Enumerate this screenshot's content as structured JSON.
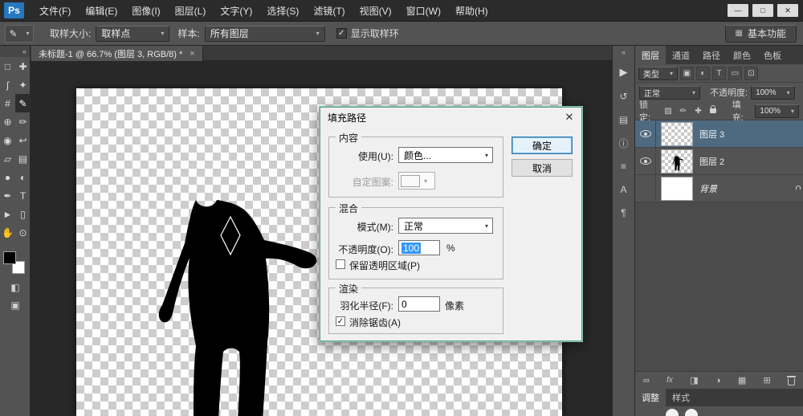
{
  "icons": {
    "check": "✓",
    "arrow": "▾",
    "collapse_left": "«",
    "play": "▶"
  },
  "menubar": {
    "logo": "Ps",
    "items": [
      "文件(F)",
      "编辑(E)",
      "图像(I)",
      "图层(L)",
      "文字(Y)",
      "选择(S)",
      "滤镜(T)",
      "视图(V)",
      "窗口(W)",
      "帮助(H)"
    ],
    "minimize": "—",
    "maximize": "□",
    "close": "✕"
  },
  "options_bar": {
    "tool_glyph": "✎",
    "sample_size_label": "取样大小:",
    "sample_size_value": "取样点",
    "sample_label": "样本:",
    "sample_value": "所有图层",
    "show_ring_label": "显示取样环",
    "workspace_glyph": "▦",
    "workspace_label": "基本功能"
  },
  "toolbar": {
    "tools": [
      {
        "name": "rectangular-marquee",
        "glyph": "□"
      },
      {
        "name": "move",
        "glyph": "✚"
      },
      {
        "name": "lasso",
        "glyph": "ʃ"
      },
      {
        "name": "quick-selection",
        "glyph": "✦"
      },
      {
        "name": "crop",
        "glyph": "#"
      },
      {
        "name": "eyedropper",
        "glyph": "✎"
      },
      {
        "name": "spot-healing",
        "glyph": "⊕"
      },
      {
        "name": "brush",
        "glyph": "✏"
      },
      {
        "name": "clone-stamp",
        "glyph": "◉"
      },
      {
        "name": "history-brush",
        "glyph": "↩"
      },
      {
        "name": "eraser",
        "glyph": "▱"
      },
      {
        "name": "gradient",
        "glyph": "▤"
      },
      {
        "name": "blur",
        "glyph": "●"
      },
      {
        "name": "dodge",
        "glyph": "◐"
      },
      {
        "name": "pen",
        "glyph": "✒"
      },
      {
        "name": "type",
        "glyph": "T"
      },
      {
        "name": "path-selection",
        "glyph": "►"
      },
      {
        "name": "shape",
        "glyph": "▯"
      },
      {
        "name": "hand",
        "glyph": "✋"
      },
      {
        "name": "zoom",
        "glyph": "⊙"
      }
    ],
    "quick_mask_glyph": "◧",
    "screen_mode_glyph": "▣"
  },
  "document": {
    "tab_title": "未标题-1 @ 66.7% (图层 3, RGB/8) *",
    "tab_close": "×"
  },
  "dialog": {
    "title": "填充路径",
    "close": "✕",
    "ok": "确定",
    "cancel": "取消",
    "content": {
      "legend": "内容",
      "use_label": "使用(U):",
      "use_value": "颜色...",
      "pattern_label": "自定图案:"
    },
    "blend": {
      "legend": "混合",
      "mode_label": "模式(M):",
      "mode_value": "正常",
      "opacity_label": "不透明度(O):",
      "opacity_value": "100",
      "opacity_unit": "%",
      "preserve_label": "保留透明区域(P)"
    },
    "render": {
      "legend": "渲染",
      "feather_label": "羽化半径(F):",
      "feather_value": "0",
      "feather_unit": "像素",
      "antialias_label": "消除锯齿(A)"
    }
  },
  "right_strip": {
    "icons": [
      {
        "name": "history",
        "glyph": "↺"
      },
      {
        "name": "swatches",
        "glyph": "▤"
      },
      {
        "name": "info",
        "glyph": "ⓘ"
      },
      {
        "name": "actions",
        "glyph": "≡"
      },
      {
        "name": "character",
        "glyph": "A"
      },
      {
        "name": "paragraph",
        "glyph": "¶"
      }
    ]
  },
  "layers_panel": {
    "tabs": [
      "图层",
      "通道",
      "路径",
      "颜色",
      "色板"
    ],
    "filter_label": "类型",
    "filter_icons": [
      {
        "name": "filter-pixel",
        "glyph": "▣"
      },
      {
        "name": "filter-adjustment",
        "glyph": "◐"
      },
      {
        "name": "filter-type",
        "glyph": "T"
      },
      {
        "name": "filter-shape",
        "glyph": "▭"
      },
      {
        "name": "filter-smart-object",
        "glyph": "⊡"
      }
    ],
    "blend_mode": "正常",
    "opacity_label": "不透明度:",
    "opacity_value": "100%",
    "lock_label": "锁定:",
    "lock_icons": [
      {
        "name": "lock-transparent",
        "glyph": "▨"
      },
      {
        "name": "lock-pixels",
        "glyph": "✏"
      },
      {
        "name": "lock-position",
        "glyph": "✚"
      }
    ],
    "fill_label": "填充:",
    "fill_value": "100%",
    "layers": [
      {
        "name": "图层 3"
      },
      {
        "name": "图层 2"
      },
      {
        "name": "背景"
      }
    ],
    "bottom_icons": [
      {
        "name": "link-layers",
        "glyph": "∞"
      },
      {
        "name": "layer-style",
        "glyph": "fx"
      },
      {
        "name": "layer-mask",
        "glyph": "◨"
      },
      {
        "name": "new-adjustment",
        "glyph": "◑"
      },
      {
        "name": "layer-group",
        "glyph": "▦"
      },
      {
        "name": "new-layer",
        "glyph": "⊞"
      }
    ],
    "bottom_tabs": [
      "调整",
      "样式"
    ]
  }
}
